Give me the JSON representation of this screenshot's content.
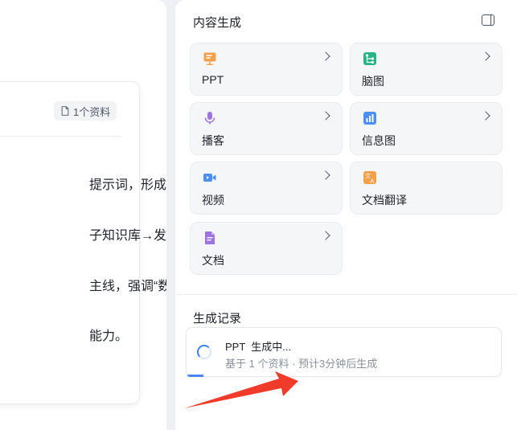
{
  "left_card": {
    "source_badge": "1个资料",
    "fragments": [
      "提示词，形成信息",
      "子知识库→发布并",
      "主线，强调“数据决",
      "能力。"
    ]
  },
  "panel": {
    "title": "内容生成",
    "tiles": [
      {
        "label": "PPT",
        "icon": "ppt-icon",
        "color": "#f29a3a"
      },
      {
        "label": "脑图",
        "icon": "mindmap-icon",
        "color": "#22b07d"
      },
      {
        "label": "播客",
        "icon": "microphone-icon",
        "color": "#9b6bd8"
      },
      {
        "label": "信息图",
        "icon": "infographic-icon",
        "color": "#3b82f6"
      },
      {
        "label": "视频",
        "icon": "video-icon",
        "color": "#3b82f6"
      },
      {
        "label": "文档翻译",
        "icon": "translate-icon",
        "color": "#f29a3a"
      },
      {
        "label": "文档",
        "icon": "document-icon",
        "color": "#9b6bd8"
      }
    ],
    "records_title": "生成记录",
    "record": {
      "title": "PPT  生成中...",
      "subtitle": "基于 1 个资料 · 预计3分钟后生成",
      "progress_percent": 5
    }
  },
  "colors": {
    "accent": "#3b82f6",
    "annotation_arrow": "#f03a2a"
  }
}
